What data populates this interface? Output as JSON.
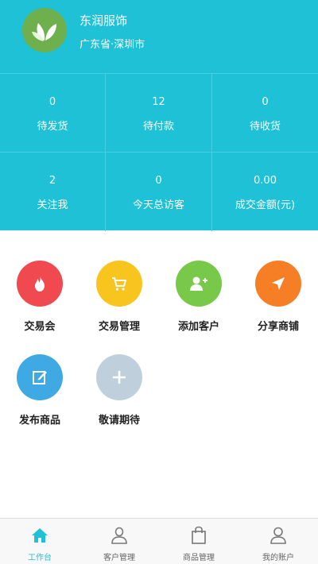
{
  "profile": {
    "name": "东润服饰",
    "location": "广东省·深圳市"
  },
  "stats": [
    {
      "value": "0",
      "label": "待发货"
    },
    {
      "value": "12",
      "label": "待付款"
    },
    {
      "value": "0",
      "label": "待收货"
    },
    {
      "value": "2",
      "label": "关注我"
    },
    {
      "value": "0",
      "label": "今天总访客"
    },
    {
      "value": "0.00",
      "label": "成交金额(元)"
    }
  ],
  "actions": [
    {
      "label": "交易会",
      "color": "#f0494f",
      "icon": "flame-icon"
    },
    {
      "label": "交易管理",
      "color": "#f8c41e",
      "icon": "cart-icon"
    },
    {
      "label": "添加客户",
      "color": "#78c84a",
      "icon": "add-user-icon"
    },
    {
      "label": "分享商铺",
      "color": "#f67e25",
      "icon": "send-icon"
    },
    {
      "label": "发布商品",
      "color": "#3fa9e3",
      "icon": "edit-icon"
    },
    {
      "label": "敬请期待",
      "color": "#bfcfdc",
      "icon": "plus-icon"
    }
  ],
  "tabs": [
    {
      "label": "工作台",
      "icon": "home-icon",
      "active": true
    },
    {
      "label": "客户管理",
      "icon": "person-icon",
      "active": false
    },
    {
      "label": "商品管理",
      "icon": "bag-icon",
      "active": false
    },
    {
      "label": "我的账户",
      "icon": "user-icon",
      "active": false
    }
  ],
  "colors": {
    "header": "#1ec1d6",
    "avatar_bg": "#6fb04e",
    "tab_active": "#1ec1d6"
  }
}
